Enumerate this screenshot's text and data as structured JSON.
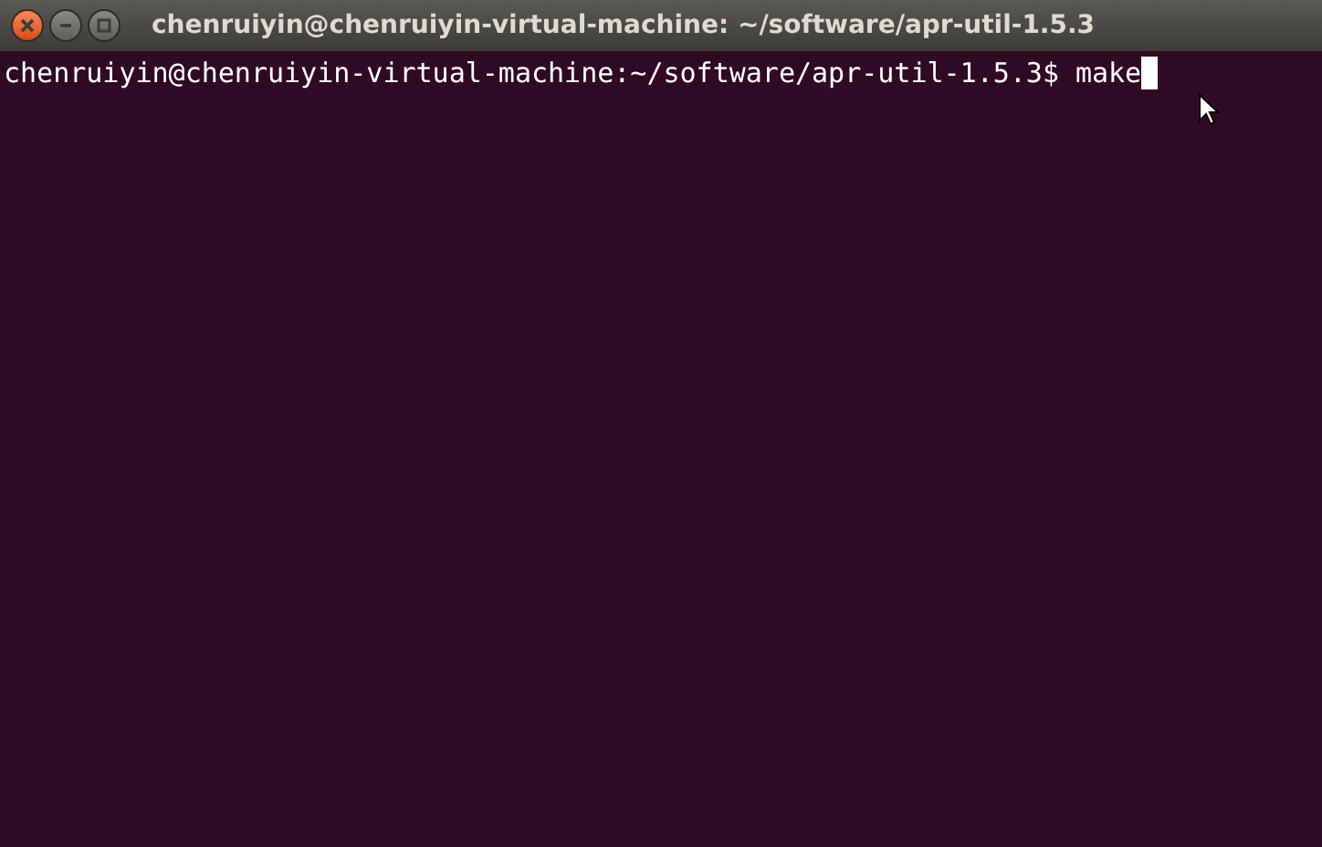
{
  "window": {
    "title": "chenruiyin@chenruiyin-virtual-machine: ~/software/apr-util-1.5.3"
  },
  "terminal": {
    "prompt": "chenruiyin@chenruiyin-virtual-machine:~/software/apr-util-1.5.3$",
    "command": "make"
  }
}
